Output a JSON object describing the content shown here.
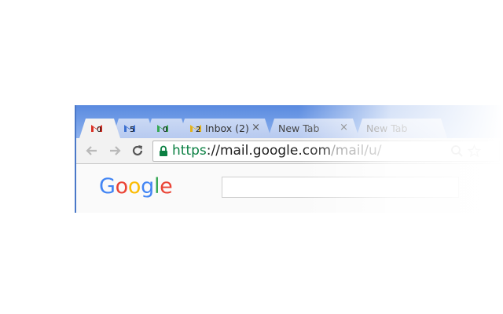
{
  "tabs": [
    {
      "icon": "gmail-icon-red",
      "badge": "0",
      "title": "",
      "active": true
    },
    {
      "icon": "gmail-icon-blue",
      "badge": "5",
      "title": ""
    },
    {
      "icon": "gmail-icon-green",
      "badge": "0",
      "title": ""
    },
    {
      "icon": "gmail-icon-yellow",
      "badge": "2",
      "title": "Inbox (2)",
      "close": "×"
    },
    {
      "title": "New Tab",
      "close": "×"
    },
    {
      "title": "New Tab"
    }
  ],
  "toolbar": {
    "back_icon": "back-arrow-icon",
    "forward_icon": "forward-arrow-icon",
    "reload_icon": "reload-icon"
  },
  "omnibox": {
    "secure_icon": "lock-icon",
    "url_scheme": "https",
    "url_sep": "://",
    "url_host": "mail.google.com",
    "url_path": "/mail/u/",
    "search_icon": "magnifier-icon",
    "bookmark_icon": "star-icon"
  },
  "page": {
    "logo": [
      "G",
      "o",
      "o",
      "g",
      "l",
      "e"
    ]
  },
  "colors": {
    "titlebar": "#6f9be6",
    "secure_green": "#0b8043",
    "logo_blue": "#4285f4",
    "logo_red": "#ea4335",
    "logo_yellow": "#fbbc05",
    "logo_green": "#34a853"
  }
}
